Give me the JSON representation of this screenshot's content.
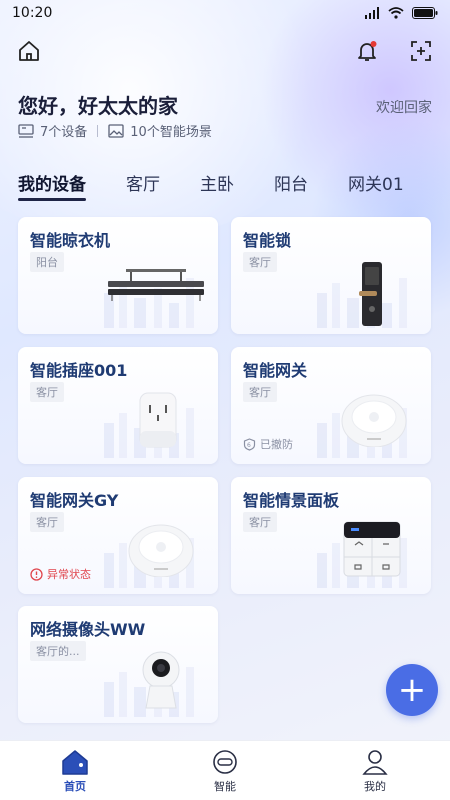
{
  "status_bar": {
    "time": "10:20"
  },
  "header": {
    "greeting": "您好，好太太的家",
    "welcome": "欢迎回家",
    "device_count": "7个设备",
    "scene_count": "10个智能场景"
  },
  "tabs": [
    "我的设备",
    "客厅",
    "主卧",
    "阳台",
    "网关01"
  ],
  "devices": [
    {
      "name": "智能晾衣机",
      "room": "阳台",
      "icon": "clothes-dryer-icon"
    },
    {
      "name": "智能锁",
      "room": "客厅",
      "icon": "smart-lock-icon"
    },
    {
      "name": "智能插座001",
      "room": "客厅",
      "icon": "smart-socket-icon"
    },
    {
      "name": "智能网关",
      "room": "客厅",
      "status": "已撤防",
      "icon": "gateway-icon"
    },
    {
      "name": "智能网关GY",
      "room": "客厅",
      "status": "异常状态",
      "icon": "gateway-icon"
    },
    {
      "name": "智能情景面板",
      "room": "客厅",
      "icon": "scene-panel-icon"
    },
    {
      "name": "网络摄像头WW",
      "room": "客厅的...",
      "icon": "camera-icon"
    }
  ],
  "fab": {
    "label": "+"
  },
  "nav": [
    {
      "label": "首页",
      "icon": "home-icon",
      "active": true
    },
    {
      "label": "智能",
      "icon": "smart-icon",
      "active": false
    },
    {
      "label": "我的",
      "icon": "profile-icon",
      "active": false
    }
  ],
  "colors": {
    "accent": "#4a6de5",
    "title": "#1f3b73",
    "warn": "#e0464e"
  }
}
